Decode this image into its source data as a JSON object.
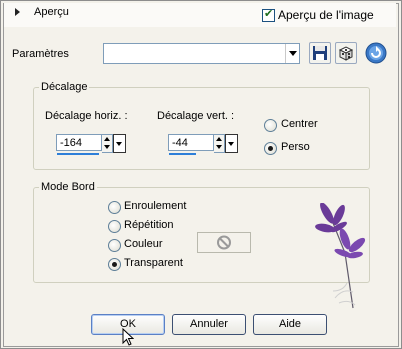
{
  "header": {
    "section_label": "Aperçu",
    "preview_checkbox_label": "Aperçu de l'image",
    "preview_checked": true
  },
  "params": {
    "label": "Paramètres",
    "preset_value": ""
  },
  "decalage": {
    "title": "Décalage",
    "horiz_label": "Décalage horiz. :",
    "horiz_value": "-164",
    "horiz_fill": 0.95,
    "vert_label": "Décalage vert. :",
    "vert_value": "-44",
    "vert_fill": 0.62,
    "radios": [
      {
        "label": "Centrer",
        "checked": false
      },
      {
        "label": "Perso",
        "checked": true
      }
    ]
  },
  "mode_bord": {
    "title": "Mode Bord",
    "radios": [
      {
        "label": "Enroulement",
        "checked": false
      },
      {
        "label": "Répétition",
        "checked": false
      },
      {
        "label": "Couleur",
        "checked": false
      },
      {
        "label": "Transparent",
        "checked": true
      }
    ]
  },
  "buttons": {
    "ok": "OK",
    "cancel": "Annuler",
    "help": "Aide"
  },
  "icons": {
    "save": "floppy-disk-icon",
    "random": "dice-icon",
    "reset": "reset-icon",
    "disabled_color": "no-symbol-icon"
  },
  "colors": {
    "accent_blue": "#2d7fd9",
    "border_blue": "#7f9db9"
  }
}
